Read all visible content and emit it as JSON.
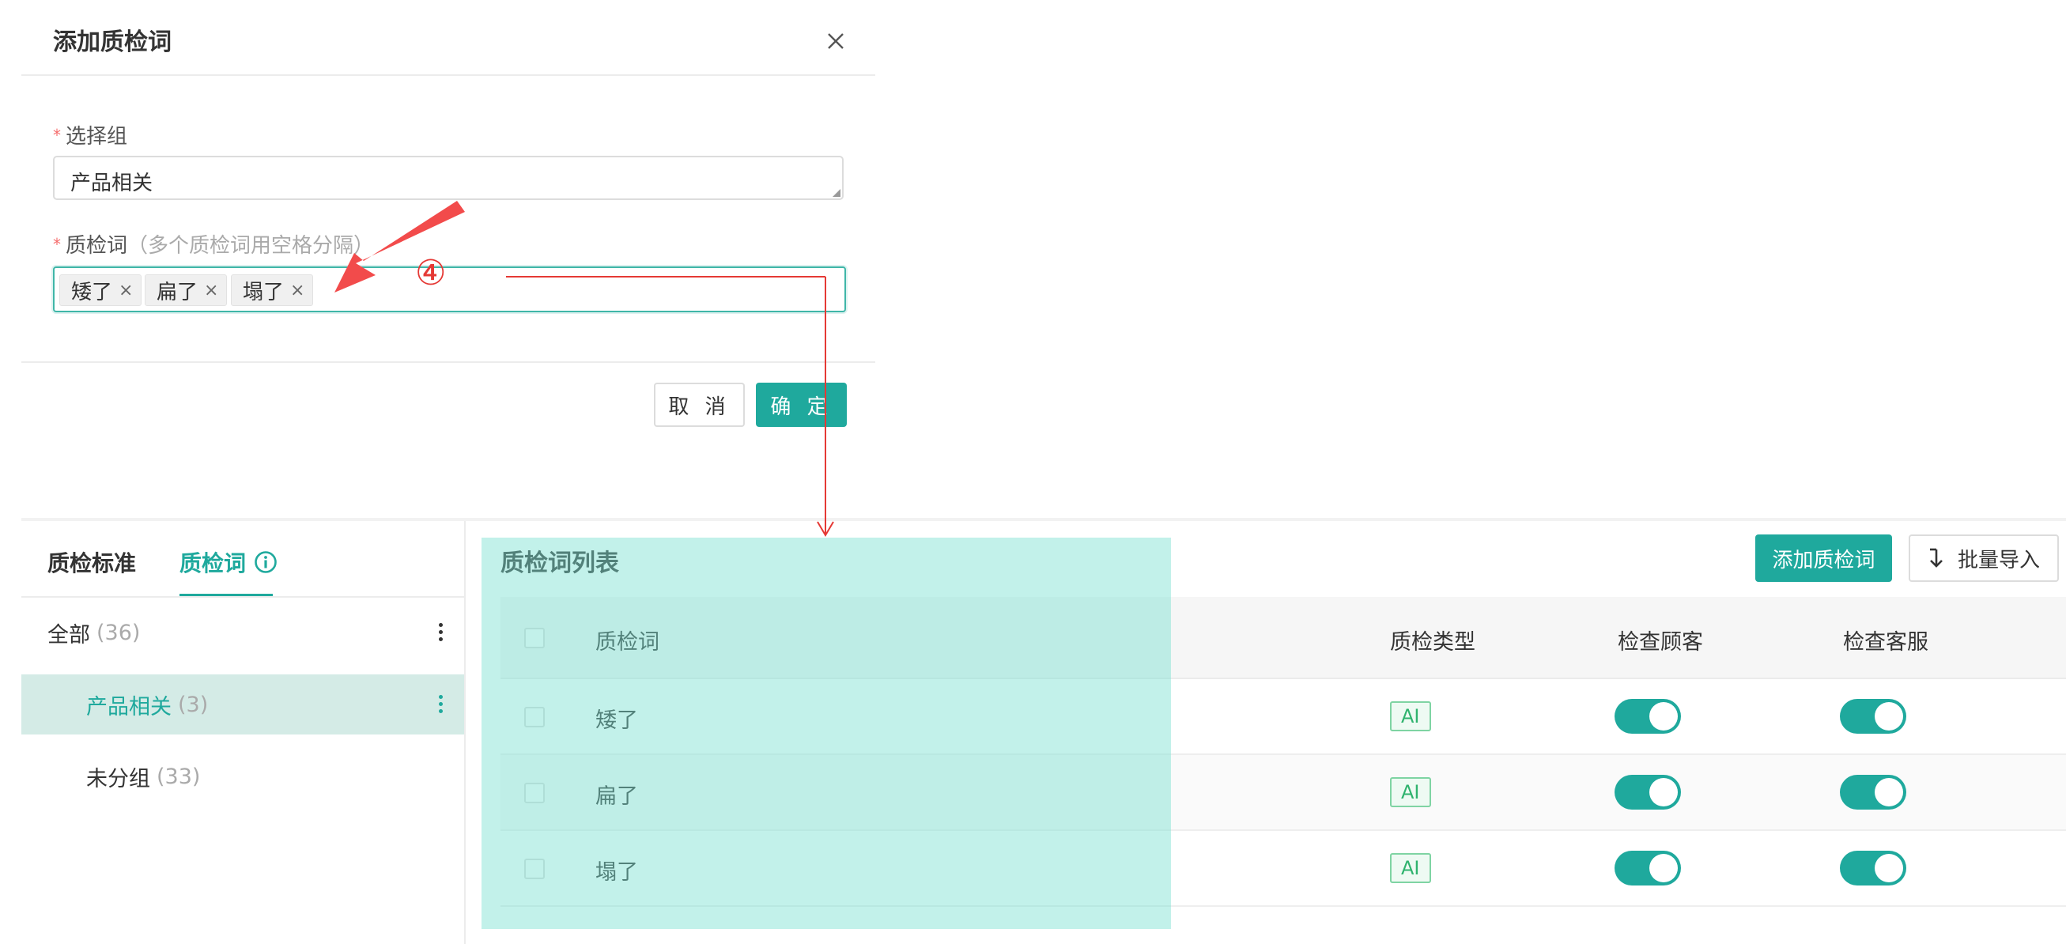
{
  "modal": {
    "title": "添加质检词",
    "group_label": "选择组",
    "group_value": "产品相关",
    "words_label": "质检词",
    "words_hint": "（多个质检词用空格分隔）",
    "tags": [
      {
        "label": "矮了",
        "close": "×"
      },
      {
        "label": "扁了",
        "close": "×"
      },
      {
        "label": "塌了",
        "close": "×"
      }
    ],
    "required_mark": "*",
    "cancel_label": "取 消",
    "ok_label": "确 定"
  },
  "annotation": {
    "step": "④",
    "color": "#e53935"
  },
  "sidebar": {
    "tabs": [
      {
        "label": "质检标准"
      },
      {
        "label": "质检词"
      }
    ],
    "groups": [
      {
        "name": "全部",
        "count": "(36)"
      },
      {
        "name": "产品相关",
        "count": "(3)"
      },
      {
        "name": "未分组",
        "count": "(33)"
      }
    ]
  },
  "main": {
    "title": "质检词列表",
    "add_label": "添加质检词",
    "import_label": "批量导入",
    "columns": [
      "质检词",
      "质检类型",
      "检查顾客",
      "检查客服"
    ],
    "rows": [
      {
        "word": "矮了",
        "type": "AI",
        "check_customer": true,
        "check_service": true
      },
      {
        "word": "扁了",
        "type": "AI",
        "check_customer": true,
        "check_service": true
      },
      {
        "word": "塌了",
        "type": "AI",
        "check_customer": true,
        "check_service": true
      }
    ]
  },
  "colors": {
    "accent": "#1fa99d",
    "highlight": "#78e0d0",
    "required": "#f56c6c"
  }
}
